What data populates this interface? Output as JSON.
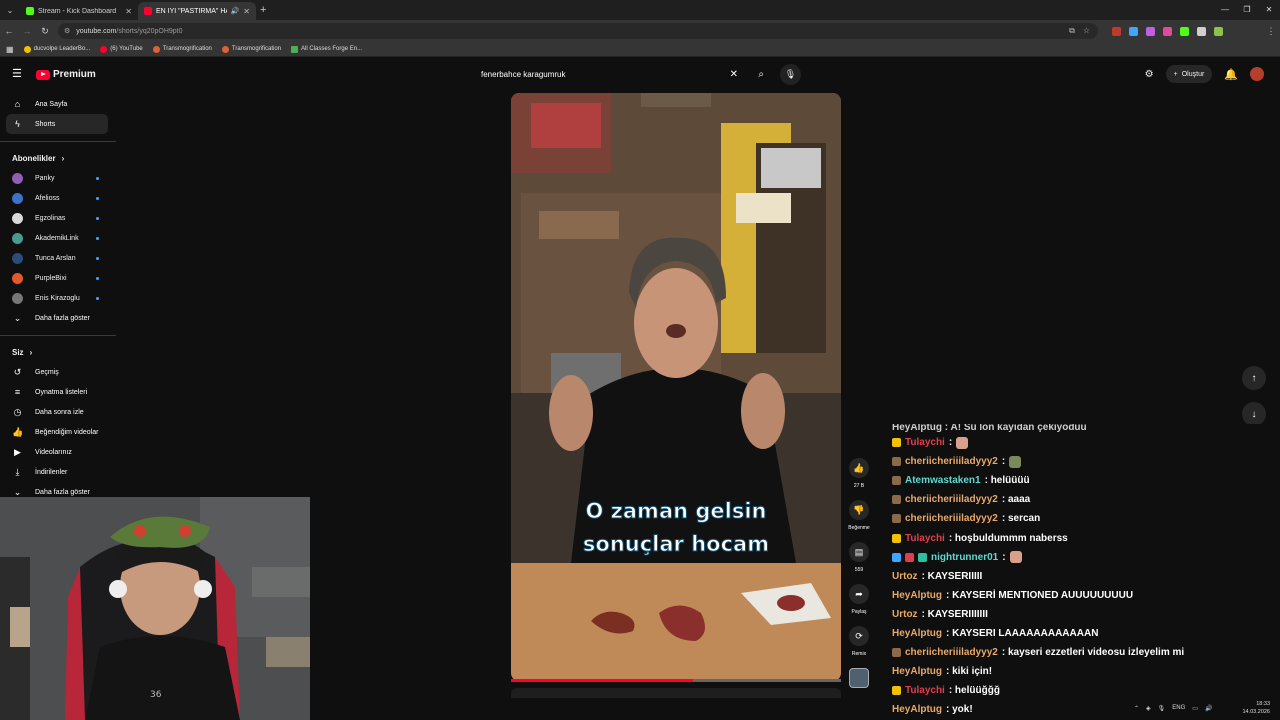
{
  "browser": {
    "tabs": [
      {
        "title": "Stream - Kick Dashboard",
        "favicon_color": "#53fc18",
        "active": false
      },
      {
        "title": "EN İYİ \"PASTIRMA\" HANGİ",
        "favicon_color": "#ff0033",
        "active": true
      }
    ],
    "address": {
      "host": "youtube.com",
      "path": "/shorts/yq20pOH9pt0"
    },
    "bookmarks": [
      {
        "label": "ducvolpe LeaderBo...",
        "icon_color": "#f2c200"
      },
      {
        "label": "(6) YouTube",
        "icon_color": "#ff0033"
      },
      {
        "label": "Transmogrification",
        "icon_color": "#e0603a"
      },
      {
        "label": "Transmogrification",
        "icon_color": "#e0603a"
      },
      {
        "label": "All Classes Forge En...",
        "icon_color": "#4caf50"
      }
    ],
    "extensions": [
      "#c0392b",
      "#3ea6ff",
      "#c060e0",
      "#e04a9a",
      "#53fc18",
      "#cfcfcf",
      "#8bc34a"
    ]
  },
  "youtube": {
    "logo_text": "Premium",
    "search_query": "fenerbahce karagumruk",
    "create_label": "Oluştur"
  },
  "sidebar": {
    "main": [
      {
        "label": "Ana Sayfa",
        "icon": "home-icon",
        "glyph": "⌂",
        "active": false
      },
      {
        "label": "Shorts",
        "icon": "shorts-icon",
        "glyph": "ϟ",
        "active": true
      }
    ],
    "subs_title": "Abonelikler",
    "channels": [
      {
        "name": "Panky",
        "color": "#8e5fb2"
      },
      {
        "name": "Afelioss",
        "color": "#3b73c9"
      },
      {
        "name": "Egzolinas",
        "color": "#d9d9d9"
      },
      {
        "name": "AkademikLink",
        "color": "#4a9b8d"
      },
      {
        "name": "Tunca Arslan",
        "color": "#2c4c7a"
      },
      {
        "name": "PurpleBixi",
        "color": "#e05a2b"
      },
      {
        "name": "Enis Kirazoglu",
        "color": "#777777"
      }
    ],
    "show_more": "Daha fazla göster",
    "you_title": "Siz",
    "you_items": [
      {
        "label": "Geçmiş",
        "icon": "history-icon",
        "glyph": "↺"
      },
      {
        "label": "Oynatma listeleri",
        "icon": "playlists-icon",
        "glyph": "≡"
      },
      {
        "label": "Daha sonra izle",
        "icon": "watch-later-icon",
        "glyph": "◷"
      },
      {
        "label": "Beğendiğim videolar",
        "icon": "liked-icon",
        "glyph": "👍"
      },
      {
        "label": "Videolarınız",
        "icon": "your-videos-icon",
        "glyph": "▶"
      },
      {
        "label": "İndirilenler",
        "icon": "downloads-icon",
        "glyph": "⤓"
      },
      {
        "label": "Daha fazla göster",
        "icon": "chevron-down-icon",
        "glyph": "⌄"
      }
    ]
  },
  "short": {
    "caption_line1": "O zaman gelsin",
    "caption_line2": "sonuçlar hocam",
    "progress_fraction": 0.55,
    "actions": {
      "like_count": "27 B",
      "dislike_label": "Beğenme",
      "comments_count": "559",
      "share_label": "Paylaş",
      "remix_label": "Remix"
    }
  },
  "chat": {
    "partial_line": "HeyAlptug : A! Sü lon kayıdan çekiyoduu",
    "messages": [
      {
        "user": "Tulaychi",
        "color": "#e03e4e",
        "badge": "crown",
        "text": ":",
        "emote": "pink"
      },
      {
        "user": "cheriicheriiiladyyy2",
        "color": "#e8a86a",
        "badge": "shield",
        "text": ":",
        "emote": "green"
      },
      {
        "user": "Atemwastaken1",
        "color": "#5fd8d0",
        "badge": "shield",
        "text": ": helüüüü",
        "emote": ""
      },
      {
        "user": "cheriicheriiiladyyy2",
        "color": "#e8a86a",
        "badge": "shield",
        "text": ": aaaa",
        "emote": ""
      },
      {
        "user": "cheriicheriiiladyyy2",
        "color": "#e8a86a",
        "badge": "shield",
        "text": ": sercan",
        "emote": ""
      },
      {
        "user": "Tulaychi",
        "color": "#e03e4e",
        "badge": "crown",
        "text": ": hoşbuldummm naberss",
        "emote": ""
      },
      {
        "user": "nightrunner01",
        "color": "#5fd8d0",
        "badge": "multi",
        "text": ":",
        "emote": "pink"
      },
      {
        "user": "Urtoz",
        "color": "#e8a86a",
        "badge": "",
        "text": ": KAYSERIIIII",
        "emote": ""
      },
      {
        "user": "HeyAlptug",
        "color": "#e8a86a",
        "badge": "",
        "text": ": KAYSERİ MENTIONED AUUUUUUUUU",
        "emote": ""
      },
      {
        "user": "Urtoz",
        "color": "#e8a86a",
        "badge": "",
        "text": ": KAYSERIIIIIII",
        "emote": ""
      },
      {
        "user": "HeyAlptug",
        "color": "#e8a86a",
        "badge": "",
        "text": ": KAYSERI LAAAAAAAAAAAAN",
        "emote": ""
      },
      {
        "user": "cheriicheriiiladyyy2",
        "color": "#e8a86a",
        "badge": "shield",
        "text": ": kayseri ezzetleri videosu izleyelim mi",
        "emote": ""
      },
      {
        "user": "HeyAlptug",
        "color": "#e8a86a",
        "badge": "",
        "text": ": kiki için!",
        "emote": ""
      },
      {
        "user": "Tulaychi",
        "color": "#e03e4e",
        "badge": "crown",
        "text": ": helüüğğğ",
        "emote": ""
      },
      {
        "user": "HeyAlptug",
        "color": "#e8a86a",
        "badge": "",
        "text": ": yok!",
        "emote": ""
      }
    ]
  },
  "taskbar": {
    "lang": "ENG",
    "time": "18:33",
    "date": "14.03.2026"
  }
}
